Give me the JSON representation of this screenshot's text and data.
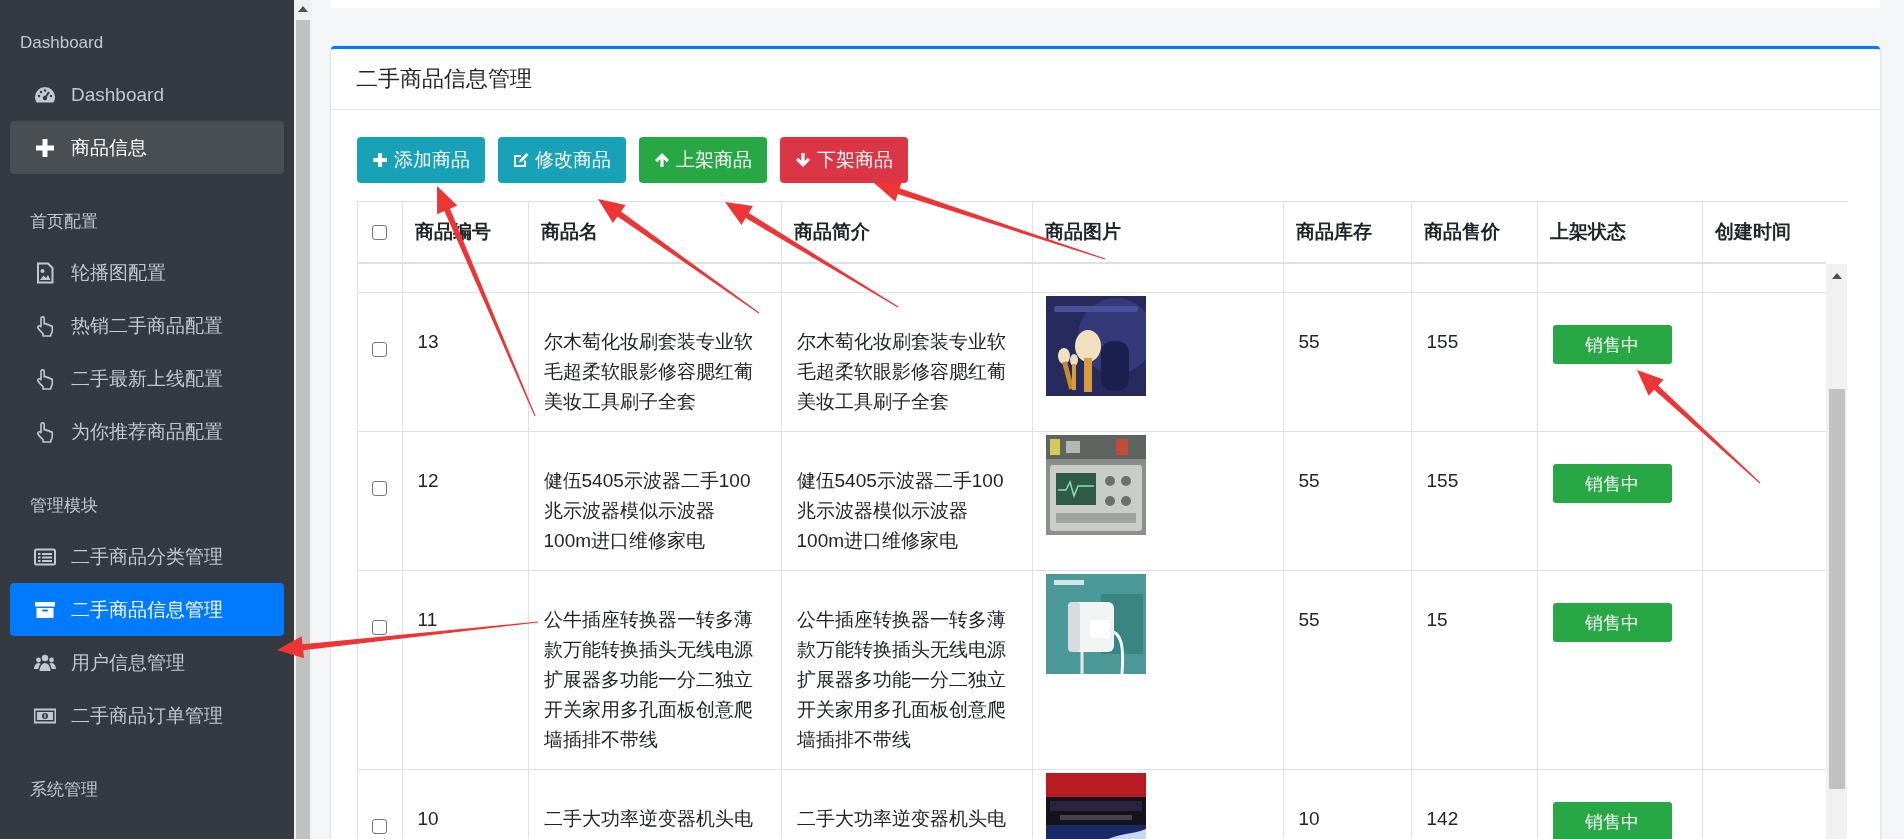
{
  "sidebar": {
    "sections": [
      {
        "title": "Dashboard",
        "items": [
          {
            "label": "Dashboard",
            "selected": false,
            "highlighted": false
          },
          {
            "label": "商品信息",
            "selected": false,
            "highlighted": true
          }
        ]
      },
      {
        "title": "首页配置",
        "items": [
          {
            "label": "轮播图配置",
            "selected": false,
            "highlighted": false
          },
          {
            "label": "热销二手商品配置",
            "selected": false,
            "highlighted": false
          },
          {
            "label": "二手最新上线配置",
            "selected": false,
            "highlighted": false
          },
          {
            "label": "为你推荐商品配置",
            "selected": false,
            "highlighted": false
          }
        ]
      },
      {
        "title": "管理模块",
        "items": [
          {
            "label": "二手商品分类管理",
            "selected": false,
            "highlighted": false
          },
          {
            "label": "二手商品信息管理",
            "selected": true,
            "highlighted": false
          },
          {
            "label": "用户信息管理",
            "selected": false,
            "highlighted": false
          },
          {
            "label": "二手商品订单管理",
            "selected": false,
            "highlighted": false
          }
        ]
      },
      {
        "title": "系统管理"
      }
    ]
  },
  "card": {
    "title": "二手商品信息管理",
    "toolbar": [
      {
        "label": "添加商品",
        "kind": "info"
      },
      {
        "label": "修改商品",
        "kind": "info"
      },
      {
        "label": "上架商品",
        "kind": "success"
      },
      {
        "label": "下架商品",
        "kind": "danger"
      }
    ]
  },
  "table": {
    "select_all": {
      "checked": false
    },
    "columns": [
      "商品编号",
      "商品名",
      "商品简介",
      "商品图片",
      "商品库存",
      "商品售价",
      "上架状态",
      "创建时间"
    ],
    "rows": [
      {
        "checked": false,
        "id": "13",
        "name": "尔木萄化妆刷套装专业软毛超柔软眼影修容腮红葡美妆工具刷子全套",
        "description": "尔木萄化妆刷套装专业软毛超柔软眼影修容腮红葡美妆工具刷子全套",
        "stock": "55",
        "price": "155",
        "status": "销售中"
      },
      {
        "checked": false,
        "id": "12",
        "name": "健伍5405示波器二手100兆示波器模似示波器100m进口维修家电",
        "description": "健伍5405示波器二手100兆示波器模似示波器100m进口维修家电",
        "stock": "55",
        "price": "155",
        "status": "销售中"
      },
      {
        "checked": false,
        "id": "11",
        "name": "公牛插座转换器一转多薄款万能转换插头无线电源扩展器多功能一分二独立开关家用多孔面板创意爬墙插排不带线",
        "description": "公牛插座转换器一转多薄款万能转换插头无线电源扩展器多功能一分二独立开关家用多孔面板创意爬墙插排不带线",
        "stock": "55",
        "price": "15",
        "status": "销售中"
      },
      {
        "checked": false,
        "id": "10",
        "name": "二手大功率逆变器机头电",
        "description": "二手大功率逆变器机头电",
        "stock": "10",
        "price": "142",
        "status": "销售中"
      }
    ]
  }
}
